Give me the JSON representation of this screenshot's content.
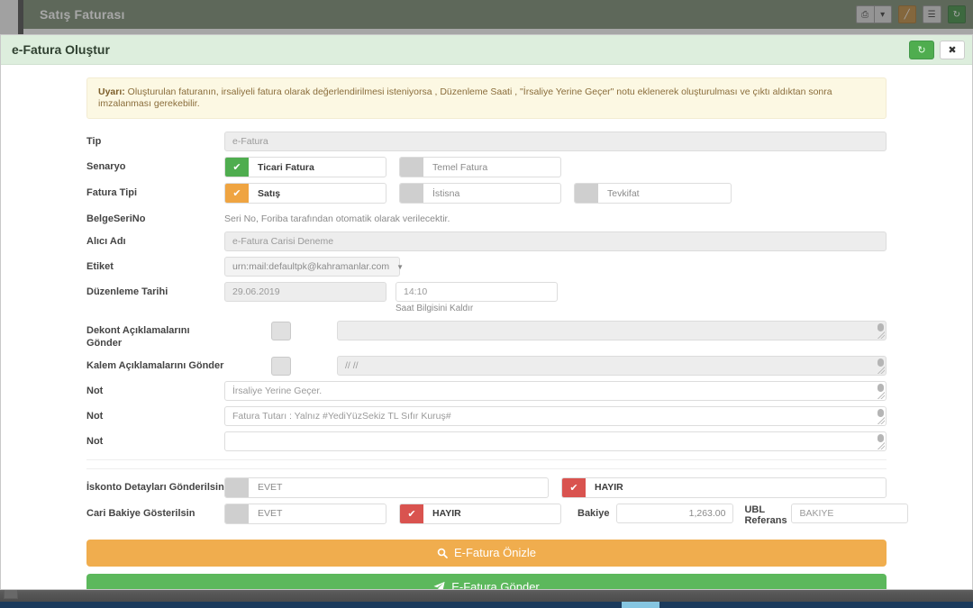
{
  "background": {
    "app_title": "Satış Faturası",
    "toolbar": [
      {
        "name": "print-button",
        "icon": "printer-icon",
        "glyph": "⎙",
        "style": "grey-split-main"
      },
      {
        "name": "print-dropdown-button",
        "icon": "caret-down-icon",
        "glyph": "▾",
        "style": "grey-split-caret"
      },
      {
        "name": "edit-button",
        "icon": "pencil-icon",
        "glyph": "╱",
        "style": "orange"
      },
      {
        "name": "menu-button",
        "icon": "hamburger-menu-icon",
        "glyph": "☰",
        "style": "grey"
      },
      {
        "name": "refresh-button",
        "icon": "refresh-icon",
        "glyph": "↻",
        "style": "green"
      }
    ]
  },
  "modal": {
    "title": "e-Fatura Oluştur",
    "header_buttons": [
      {
        "name": "modal-refresh-button",
        "icon": "refresh-icon",
        "glyph": "↻",
        "style": "green"
      },
      {
        "name": "modal-close-button",
        "icon": "close-icon",
        "glyph": "✖",
        "style": "white"
      }
    ],
    "warning": {
      "prefix": "Uyarı:",
      "text": " Oluşturulan faturanın, irsaliyeli fatura olarak değerlendirilmesi isteniyorsa , Düzenleme Saati , \"İrsaliye Yerine Geçer\" notu eklenerek oluşturulması ve çıktı aldıktan sonra imzalanması gerekebilir."
    },
    "form": {
      "tip": {
        "label": "Tip",
        "value": "e-Fatura"
      },
      "senaryo": {
        "label": "Senaryo",
        "options": [
          {
            "label": "Ticari Fatura",
            "selected": true,
            "color": "green"
          },
          {
            "label": "Temel Fatura",
            "selected": false,
            "color": "grey"
          }
        ]
      },
      "fatura_tipi": {
        "label": "Fatura Tipi",
        "options": [
          {
            "label": "Satış",
            "selected": true,
            "color": "orange"
          },
          {
            "label": "İstisna",
            "selected": false,
            "color": "grey"
          },
          {
            "label": "Tevkifat",
            "selected": false,
            "color": "grey"
          }
        ]
      },
      "belge_seri_no": {
        "label": "BelgeSeriNo",
        "hint": "Seri No, Foriba tarafından otomatik olarak verilecektir."
      },
      "alici_adi": {
        "label": "Alıcı Adı",
        "value": "e-Fatura Carisi Deneme"
      },
      "etiket": {
        "label": "Etiket",
        "value": "urn:mail:defaultpk@kahramanlar.com"
      },
      "duzenleme_tarihi": {
        "label": "Düzenleme Tarihi",
        "date": "29.06.2019",
        "time": "14:10",
        "clear_time_link": "Saat Bilgisini Kaldır"
      },
      "dekont_aciklama": {
        "label": "Dekont Açıklamalarını Gönder",
        "checked": false,
        "value": ""
      },
      "kalem_aciklama": {
        "label": "Kalem Açıklamalarını Gönder",
        "checked": false,
        "value": "//  //"
      },
      "notlar": [
        {
          "label": "Not",
          "value": "İrsaliye Yerine Geçer."
        },
        {
          "label": "Not",
          "value": "Fatura Tutarı : Yalnız #YediYüzSekiz TL Sıfır Kuruş#"
        },
        {
          "label": "Not",
          "value": ""
        }
      ],
      "iskonto": {
        "label": "İskonto Detayları Gönderilsin",
        "options": [
          {
            "label": "EVET",
            "selected": false,
            "color": "grey"
          },
          {
            "label": "HAYIR",
            "selected": true,
            "color": "red"
          }
        ]
      },
      "cari_bakiye": {
        "label": "Cari Bakiye Gösterilsin",
        "options": [
          {
            "label": "EVET",
            "selected": false,
            "color": "grey"
          },
          {
            "label": "HAYIR",
            "selected": true,
            "color": "red"
          }
        ],
        "bakiye_label": "Bakiye",
        "bakiye_value": "1,263.00",
        "ubl_label": "UBL Referans",
        "ubl_value": "BAKIYE"
      }
    },
    "actions": {
      "preview": {
        "label": "E-Fatura Önizle",
        "icon": "search-icon",
        "color": "#f0ad4e"
      },
      "send": {
        "label": "E-Fatura Gönder",
        "icon": "paper-plane-icon",
        "color": "#5cb85c"
      }
    }
  }
}
